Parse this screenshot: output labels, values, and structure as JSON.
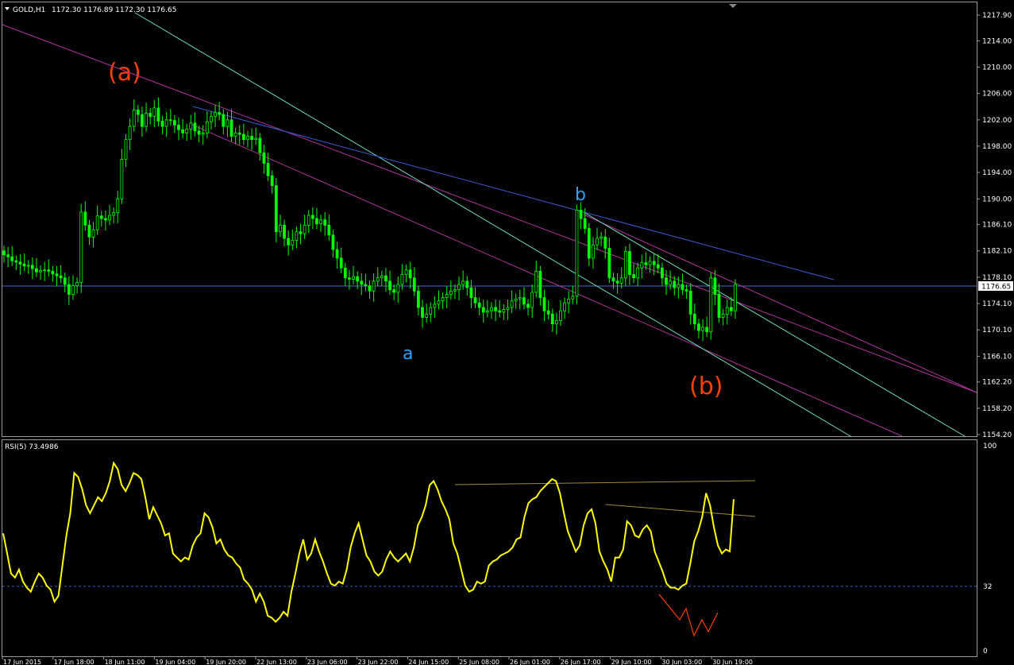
{
  "header": {
    "symbol_timeframe": "GOLD,H1",
    "ohlc": "1172.30 1176.89 1172.30 1176.65"
  },
  "price_axis": {
    "ticks": [
      "1217.90",
      "1214.00",
      "1210.00",
      "1206.00",
      "1202.00",
      "1198.00",
      "1194.00",
      "1190.00",
      "1186.10",
      "1182.10",
      "1178.10",
      "1174.10",
      "1170.10",
      "1166.10",
      "1162.20",
      "1158.20",
      "1154.20"
    ],
    "current_price": "1176.65"
  },
  "rsi_panel": {
    "label": "RSI(5) 73.4986",
    "levels": [
      "100",
      "32",
      "0"
    ]
  },
  "time_axis": {
    "labels": [
      "17 Jun 2015",
      "17 Jun 18:00",
      "18 Jun 11:00",
      "19 Jun 04:00",
      "19 Jun 20:00",
      "22 Jun 13:00",
      "23 Jun 06:00",
      "23 Jun 22:00",
      "24 Jun 15:00",
      "25 Jun 08:00",
      "26 Jun 01:00",
      "26 Jun 17:00",
      "29 Jun 10:00",
      "30 Jun 03:00",
      "30 Jun 19:00"
    ]
  },
  "annotations": {
    "wave_a_upper": "(a)",
    "wave_b_upper": "(b)",
    "wave_a_lower": "a",
    "wave_b_lower": "b"
  },
  "colors": {
    "background": "#000000",
    "candle": "#00ff00",
    "rsi_line": "#ffff00",
    "wave_label_orange": "#ff4000",
    "wave_label_blue": "#29a3ff",
    "trendline_blue": "#3b5bdb",
    "trendline_magenta": "#b0359a",
    "trendline_cyan": "#6fe0c0",
    "rsi_trendline": "#a08a3a",
    "grid_axis": "#c0c0c0"
  },
  "chart_data": [
    {
      "type": "candlestick",
      "title": "GOLD,H1",
      "ylim": [
        1153.0,
        1219.0
      ],
      "x_labels": [
        "17 Jun 2015",
        "17 Jun 18:00",
        "18 Jun 11:00",
        "19 Jun 04:00",
        "19 Jun 20:00",
        "22 Jun 13:00",
        "23 Jun 06:00",
        "23 Jun 22:00",
        "24 Jun 15:00",
        "25 Jun 08:00",
        "26 Jun 01:00",
        "26 Jun 17:00",
        "29 Jun 10:00",
        "30 Jun 03:00",
        "30 Jun 19:00"
      ],
      "close_series": [
        1181.5,
        1181.2,
        1180.6,
        1180.4,
        1180.1,
        1179.8,
        1179.9,
        1179.4,
        1178.9,
        1179.1,
        1179.2,
        1179.0,
        1178.6,
        1178.3,
        1178.0,
        1177.0,
        1175.5,
        1176.8,
        1177.3,
        1188.0,
        1186.0,
        1184.2,
        1185.3,
        1187.4,
        1187.0,
        1186.8,
        1187.5,
        1187.9,
        1190.0,
        1196.0,
        1199.0,
        1201.0,
        1203.5,
        1202.8,
        1201.0,
        1203.0,
        1202.5,
        1203.8,
        1201.8,
        1201.0,
        1202.0,
        1201.9,
        1201.2,
        1200.5,
        1200.0,
        1200.6,
        1201.5,
        1200.3,
        1199.8,
        1200.0,
        1201.7,
        1202.5,
        1203.1,
        1202.8,
        1201.0,
        1202.0,
        1199.5,
        1200.0,
        1199.8,
        1199.0,
        1199.5,
        1199.0,
        1199.2,
        1197.0,
        1195.4,
        1193.5,
        1192.0,
        1185.0,
        1186.0,
        1184.0,
        1183.0,
        1183.7,
        1185.0,
        1184.7,
        1186.0,
        1187.5,
        1187.0,
        1186.2,
        1186.8,
        1186.0,
        1184.5,
        1182.3,
        1181.0,
        1179.5,
        1178.0,
        1177.8,
        1178.2,
        1177.5,
        1177.0,
        1176.8,
        1176.0,
        1177.5,
        1178.0,
        1178.3,
        1177.5,
        1176.2,
        1175.8,
        1177.0,
        1178.5,
        1179.2,
        1178.0,
        1176.0,
        1173.5,
        1172.0,
        1172.5,
        1173.5,
        1174.0,
        1174.5,
        1175.0,
        1175.5,
        1176.0,
        1176.2,
        1177.0,
        1177.5,
        1176.5,
        1175.0,
        1174.2,
        1173.5,
        1172.8,
        1173.0,
        1173.5,
        1173.0,
        1172.8,
        1173.2,
        1173.5,
        1174.5,
        1174.8,
        1175.0,
        1174.0,
        1173.5,
        1175.8,
        1179.0,
        1175.0,
        1173.0,
        1172.5,
        1171.0,
        1171.5,
        1173.0,
        1174.2,
        1174.8,
        1175.2,
        1188.3,
        1187.0,
        1185.5,
        1181.0,
        1183.0,
        1184.0,
        1184.2,
        1182.5,
        1178.0,
        1177.5,
        1177.2,
        1178.0,
        1182.0,
        1178.5,
        1178.0,
        1179.5,
        1180.3,
        1180.0,
        1180.5,
        1180.0,
        1179.5,
        1178.0,
        1177.0,
        1177.5,
        1176.5,
        1177.0,
        1176.2,
        1176.0,
        1172.5,
        1171.0,
        1170.0,
        1170.5,
        1169.8,
        1178.0,
        1175.5,
        1172.0,
        1172.5,
        1173.5,
        1173.0,
        1177.0
      ],
      "rsi_series": [
        56,
        46,
        36,
        34,
        38,
        32,
        29,
        27,
        32,
        36,
        34,
        30,
        28,
        22,
        25,
        40,
        55,
        66,
        86,
        84,
        78,
        70,
        66,
        70,
        74,
        72,
        76,
        82,
        91,
        88,
        80,
        77,
        81,
        86,
        85,
        83,
        74,
        63,
        69,
        65,
        61,
        55,
        56,
        46,
        44,
        42,
        44,
        43,
        50,
        54,
        56,
        66,
        64,
        59,
        51,
        53,
        48,
        45,
        44,
        41,
        39,
        33,
        31,
        28,
        22,
        26,
        22,
        15,
        14,
        12,
        14,
        17,
        15,
        27,
        36,
        46,
        53,
        43,
        46,
        53,
        47,
        42,
        36,
        31,
        30,
        32,
        31,
        38,
        49,
        56,
        61,
        53,
        45,
        42,
        37,
        35,
        37,
        43,
        47,
        44,
        42,
        44,
        46,
        42,
        49,
        60,
        64,
        70,
        80,
        82,
        78,
        72,
        68,
        63,
        51,
        46,
        38,
        30,
        27,
        28,
        32,
        31,
        32,
        40,
        42,
        43,
        45,
        46,
        47,
        49,
        53,
        54,
        64,
        71,
        73,
        74,
        77,
        79,
        81,
        83,
        82,
        76,
        66,
        57,
        52,
        47,
        50,
        60,
        66,
        68,
        61,
        47,
        42,
        38,
        32,
        44,
        44,
        48,
        62,
        60,
        55,
        54,
        58,
        60,
        57,
        47,
        42,
        37,
        31,
        29,
        29,
        28,
        30,
        31,
        41,
        52,
        57,
        64,
        76,
        70,
        59,
        50,
        46,
        48,
        47,
        73
      ],
      "price_levels": [
        1217.9,
        1214.0,
        1210.0,
        1206.0,
        1202.0,
        1198.0,
        1194.0,
        1190.0,
        1186.1,
        1182.1,
        1178.1,
        1174.1,
        1170.1,
        1166.1,
        1162.2,
        1158.2,
        1154.2
      ],
      "current_price": 1176.65
    }
  ]
}
